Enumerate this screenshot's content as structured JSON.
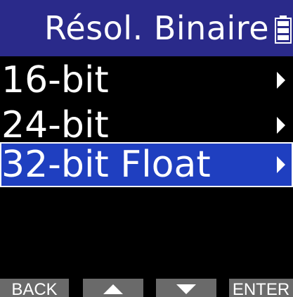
{
  "header": {
    "title": "Résol. Binaire",
    "battery_icon": "battery-icon"
  },
  "menu": {
    "items": [
      {
        "label": "16-bit",
        "selected": false,
        "icon": "chevron-right-icon"
      },
      {
        "label": "24-bit",
        "selected": false,
        "icon": "chevron-right-icon"
      },
      {
        "label": "32-bit Float",
        "selected": true,
        "icon": "chevron-right-icon"
      }
    ]
  },
  "softkeys": {
    "back_label": "BACK",
    "up_icon": "triangle-up-icon",
    "down_icon": "triangle-down-icon",
    "enter_label": "ENTER"
  },
  "colors": {
    "header_bg": "#2a2a8a",
    "selected_bg": "#1f3fc0",
    "softkey_bg": "#6a6a6a",
    "background": "#000000",
    "text": "#ffffff"
  }
}
